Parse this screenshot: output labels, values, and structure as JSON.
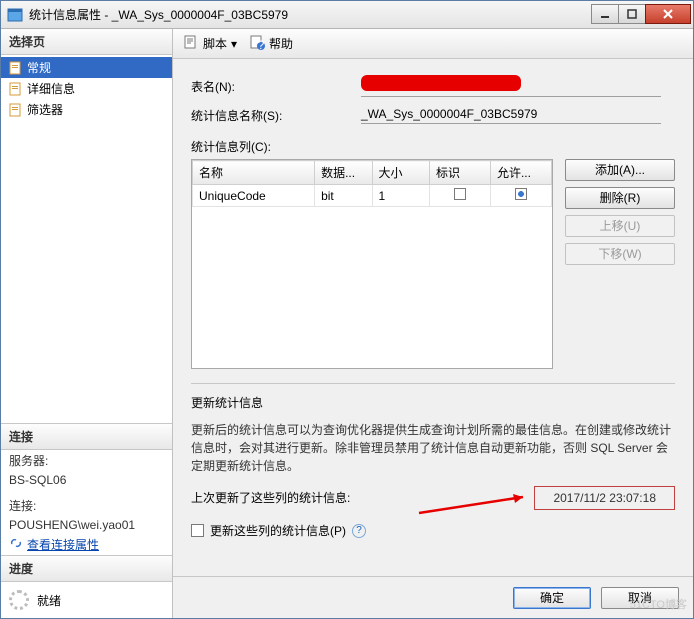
{
  "window": {
    "title": "统计信息属性 - _WA_Sys_0000004F_03BC5979"
  },
  "sidebar": {
    "select_page": "选择页",
    "items": [
      {
        "label": "常规",
        "selected": true
      },
      {
        "label": "详细信息",
        "selected": false
      },
      {
        "label": "筛选器",
        "selected": false
      }
    ],
    "connection": {
      "title": "连接",
      "server_label": "服务器:",
      "server_value": "BS-SQL06",
      "conn_label": "连接:",
      "conn_value": "POUSHENG\\wei.yao01",
      "link": "查看连接属性"
    },
    "progress": {
      "title": "进度",
      "status": "就绪"
    }
  },
  "toolbar": {
    "script": "脚本",
    "help": "帮助"
  },
  "form": {
    "table_label": "表名(N):",
    "stat_name_label": "统计信息名称(S):",
    "stat_name_value": "_WA_Sys_0000004F_03BC5979",
    "columns_label": "统计信息列(C):"
  },
  "grid": {
    "headers": {
      "name": "名称",
      "dtype": "数据...",
      "size": "大小",
      "flag": "标识",
      "allow": "允许..."
    },
    "rows": [
      {
        "name": "UniqueCode",
        "dtype": "bit",
        "size": "1",
        "flag": false,
        "allow": true
      }
    ]
  },
  "buttons": {
    "add": "添加(A)...",
    "remove": "删除(R)",
    "up": "上移(U)",
    "down": "下移(W)"
  },
  "update": {
    "section": "更新统计信息",
    "info": "更新后的统计信息可以为查询优化器提供生成查询计划所需的最佳信息。在创建或修改统计信息时，会对其进行更新。除非管理员禁用了统计信息自动更新功能，否则 SQL Server 会定期更新统计信息。",
    "last_label": "上次更新了这些列的统计信息:",
    "last_value": "2017/11/2 23:07:18",
    "checkbox": "更新这些列的统计信息(P)"
  },
  "footer": {
    "ok": "确定",
    "cancel": "取消"
  },
  "watermark": "51CTO博客"
}
